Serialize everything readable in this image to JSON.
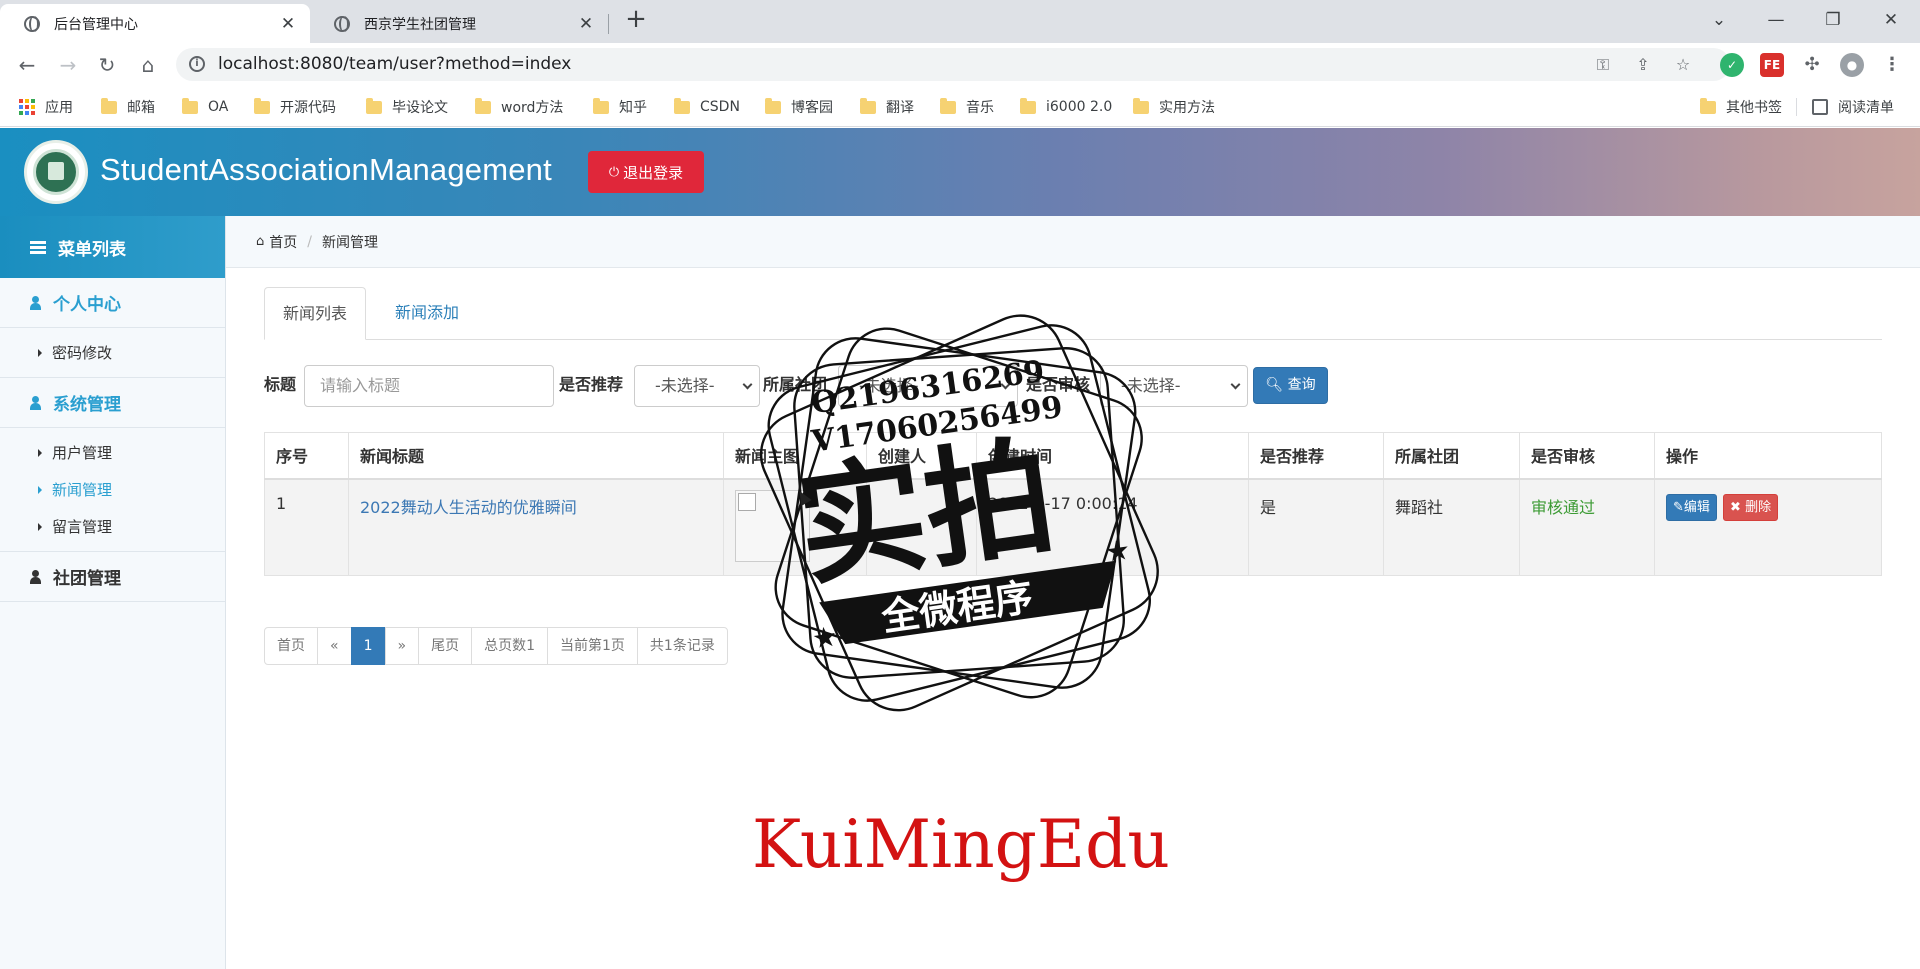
{
  "browser": {
    "tabs": [
      {
        "title": "后台管理中心",
        "active": true
      },
      {
        "title": "西京学生社团管理",
        "active": false
      }
    ],
    "url": "localhost:8080/team/user?method=index",
    "window_controls": [
      "chevron-down-icon",
      "minimize-icon",
      "restore-icon",
      "close-icon"
    ],
    "bookmarks": [
      "应用",
      "邮箱",
      "OA",
      "开源代码",
      "毕设论文",
      "word方法",
      "知乎",
      "CSDN",
      "博客园",
      "翻译",
      "音乐",
      "i6000 2.0",
      "实用方法"
    ],
    "other_bookmarks": "其他书签",
    "reading_list": "阅读清单"
  },
  "header": {
    "title": "StudentAssociationManagement",
    "logout_label": "退出登录",
    "brand_color": "#1a8fc1",
    "logout_color": "#e0273a"
  },
  "sidebar": {
    "menu_title": "菜单列表",
    "groups": [
      {
        "label": "个人中心",
        "items": [
          "密码修改"
        ]
      },
      {
        "label": "系统管理",
        "items": [
          "用户管理",
          "新闻管理",
          "留言管理"
        ],
        "active_item": "新闻管理"
      },
      {
        "label": "社团管理",
        "items": []
      }
    ]
  },
  "breadcrumb": {
    "home": "首页",
    "current": "新闻管理"
  },
  "content_tabs": [
    "新闻列表",
    "新闻添加"
  ],
  "search": {
    "title_label": "标题",
    "title_placeholder": "请输入标题",
    "recommend_label": "是否推荐",
    "recommend_value": "-未选择-",
    "club_label": "所属社团",
    "club_value": "-未选择-",
    "review_label": "是否审核",
    "review_value": "-未选择-",
    "query_label": "查询"
  },
  "table": {
    "headers": [
      "序号",
      "新闻标题",
      "新闻主图",
      "创建人",
      "创建时间",
      "是否推荐",
      "所属社团",
      "是否审核",
      "操作"
    ],
    "rows": [
      {
        "index": "1",
        "title": "2022舞动人生活动的优雅瞬间",
        "creator": "",
        "created": "2022-0-17 0:00:14",
        "recommended": "是",
        "club": "舞蹈社",
        "status": "审核通过",
        "edit": "编辑",
        "delete": "删除"
      }
    ]
  },
  "pagination": [
    "首页",
    "«",
    "1",
    "»",
    "尾页",
    "总页数1",
    "当前第1页",
    "共1条记录"
  ],
  "watermark": {
    "qq": "Q2196316269",
    "vx": "V17060256499",
    "big": "实拍",
    "banner": "全微程序",
    "footer": "KuiMingEdu"
  }
}
